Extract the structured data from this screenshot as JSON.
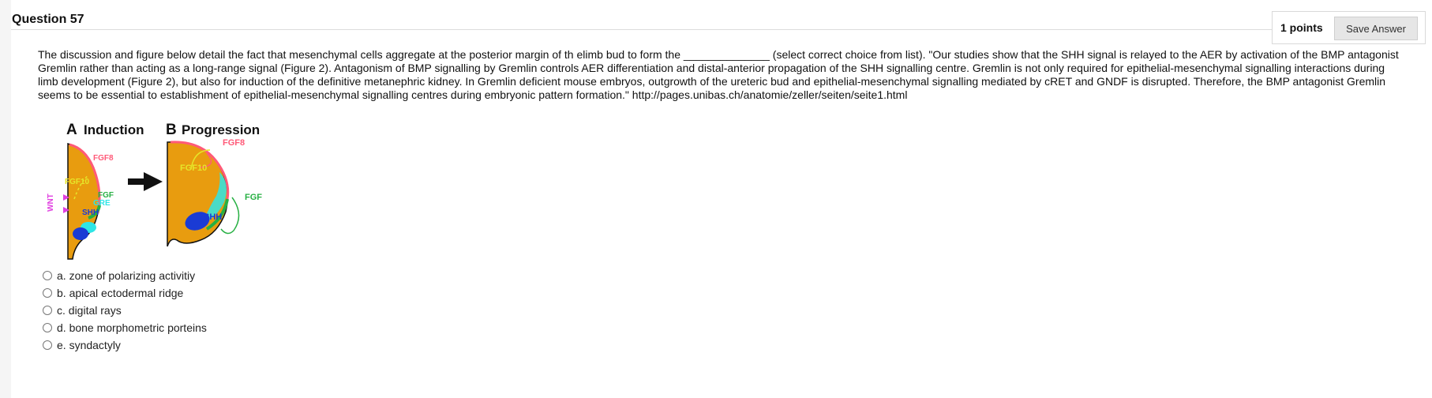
{
  "question": {
    "title": "Question 57",
    "points": "1 points",
    "save_label": "Save Answer",
    "prompt": "The discussion and figure below detail the fact that mesenchymal cells aggregate at the posterior margin of th elimb bud to form the ______________ (select correct choice from list). \"Our studies show that the SHH signal is relayed to the AER by activation of the BMP antagonist Gremlin rather than acting as a long-range signal (Figure 2). Antagonism of BMP signalling by Gremlin controls AER differentiation and distal-anterior propagation of the SHH signalling centre. Gremlin is not only required for epithelial-mesenchymal signalling interactions during limb development (Figure 2), but also for induction of the definitive metanephric kidney. In Gremlin deficient mouse embryos, outgrowth of the ureteric bud and epithelial-mesenchymal signalling mediated by cRET and GNDF is disrupted. Therefore, the BMP antagonist Gremlin seems to be essential to establishment of epithelial-mesenchymal signalling centres during embryonic pattern formation.\" http://pages.unibas.ch/anatomie/zeller/seiten/seite1.html",
    "figure": {
      "panel_a_letter": "A",
      "panel_a_title": "Induction",
      "panel_b_letter": "B",
      "panel_b_title": "Progression",
      "labels": {
        "wnt": "WNT",
        "fgf8_a": "FGF8",
        "fgf10_a": "FGF10",
        "fgf_a": "FGF",
        "gre_a": "GRE",
        "shh_a": "SHH",
        "fgf8_b": "FGF8",
        "fgf10_b": "FGF10",
        "fgf_b": "FGF",
        "shh_b": "SHH"
      },
      "colors": {
        "mesenchyme": "#e89c0f",
        "fgf8": "#ff5a78",
        "fgf10": "#e6e629",
        "fgf": "#27b043",
        "gre": "#2ee6e6",
        "shh": "#1a3bd4",
        "wnt": "#e040e0"
      }
    },
    "choices": [
      "a. zone of polarizing activitiy",
      "b. apical ectodermal ridge",
      "c. digital rays",
      "d. bone morphometric porteins",
      "e. syndactyly"
    ]
  }
}
